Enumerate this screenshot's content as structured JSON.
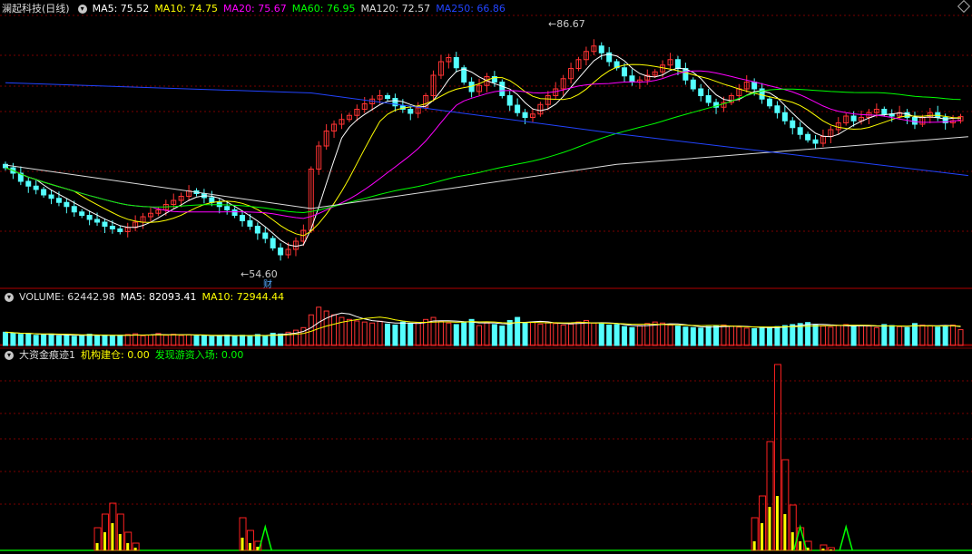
{
  "stock": {
    "name": "澜起科技(日线)"
  },
  "price_panel": {
    "ma": [
      {
        "key": "MA5",
        "text": "MA5: 75.52",
        "color": "#ffffff"
      },
      {
        "key": "MA10",
        "text": "MA10: 74.75",
        "color": "#ffff00"
      },
      {
        "key": "MA20",
        "text": "MA20: 75.67",
        "color": "#ff00ff"
      },
      {
        "key": "MA60",
        "text": "MA60: 76.95",
        "color": "#00ff00"
      },
      {
        "key": "MA120",
        "text": "MA120: 72.57",
        "color": "#dddddd"
      },
      {
        "key": "MA250",
        "text": "MA250: 66.86",
        "color": "#2244ff"
      }
    ],
    "high_label": "86.67",
    "low_label": "54.60",
    "event_tag": "财"
  },
  "volume_panel": {
    "title": "VOLUME: 62442.98",
    "ma5": "MA5: 82093.41",
    "ma10": "MA10: 72944.44"
  },
  "indicator_panel": {
    "title": "大资金痕迹1",
    "line1": "机构建仓: 0.00",
    "line2": "发现游资入场: 0.00"
  },
  "colors": {
    "up": "#ff3333",
    "down": "#54ffff",
    "bg": "#000000",
    "grid": "#7a0000"
  },
  "chart_data": {
    "type": "candlestick",
    "ylim": [
      52,
      90
    ],
    "closes": [
      68.0,
      67.2,
      66.0,
      65.3,
      64.8,
      64.0,
      63.5,
      62.9,
      62.3,
      61.5,
      61.0,
      60.4,
      60.0,
      59.4,
      59.0,
      58.6,
      59.2,
      60.0,
      60.8,
      61.3,
      61.8,
      62.6,
      63.2,
      63.8,
      64.6,
      64.2,
      63.6,
      62.9,
      62.3,
      61.8,
      61.0,
      60.2,
      59.4,
      58.4,
      57.6,
      56.2,
      55.2,
      56.0,
      57.2,
      58.8,
      67.8,
      71.2,
      73.4,
      74.4,
      75.1,
      75.7,
      76.6,
      77.4,
      78.1,
      78.6,
      78.2,
      77.1,
      76.6,
      76.0,
      76.8,
      78.6,
      81.6,
      83.6,
      84.2,
      82.7,
      80.6,
      79.2,
      80.1,
      81.4,
      80.6,
      78.6,
      77.2,
      76.1,
      75.4,
      75.9,
      77.3,
      78.6,
      79.6,
      81.1,
      82.6,
      83.9,
      85.1,
      85.9,
      84.9,
      83.6,
      82.7,
      81.5,
      80.6,
      80.9,
      81.6,
      82.1,
      83.1,
      83.9,
      82.6,
      80.9,
      79.6,
      78.6,
      77.6,
      76.9,
      77.6,
      78.6,
      79.6,
      80.6,
      79.6,
      78.1,
      77.1,
      76.1,
      74.9,
      73.9,
      72.9,
      72.1,
      71.6,
      72.6,
      73.6,
      74.6,
      75.6,
      74.9,
      75.4,
      76.1,
      76.6,
      75.9,
      75.6,
      76.1,
      75.4,
      74.4,
      75.4,
      76.1,
      75.4,
      74.6,
      74.9,
      75.52
    ],
    "volumes": [
      52,
      48,
      44,
      46,
      40,
      42,
      45,
      38,
      41,
      36,
      40,
      44,
      39,
      41,
      37,
      40,
      43,
      46,
      38,
      41,
      47,
      40,
      44,
      39,
      42,
      37,
      40,
      35,
      38,
      41,
      36,
      40,
      39,
      43,
      37,
      48,
      45,
      52,
      60,
      70,
      120,
      150,
      135,
      120,
      110,
      102,
      96,
      92,
      88,
      95,
      84,
      80,
      92,
      86,
      90,
      102,
      110,
      96,
      88,
      82,
      92,
      102,
      78,
      88,
      82,
      76,
      98,
      110,
      88,
      92,
      84,
      90,
      86,
      80,
      84,
      92,
      98,
      88,
      85,
      80,
      82,
      74,
      70,
      78,
      86,
      92,
      88,
      80,
      76,
      72,
      70,
      68,
      74,
      78,
      80,
      76,
      72,
      68,
      66,
      72,
      70,
      74,
      78,
      82,
      86,
      90,
      80,
      76,
      72,
      78,
      82,
      74,
      78,
      76,
      70,
      82,
      78,
      74,
      70,
      86,
      80,
      78,
      72,
      76,
      80,
      62
    ]
  }
}
